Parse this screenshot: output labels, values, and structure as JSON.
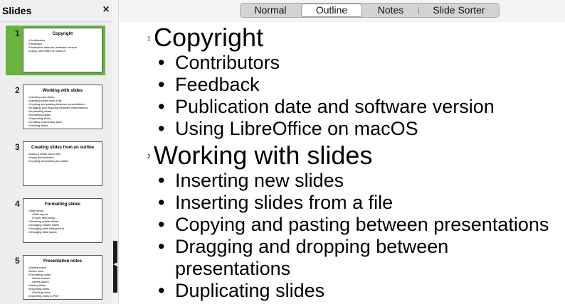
{
  "slides_pane": {
    "title": "Slides",
    "close_glyph": "×",
    "slides": [
      {
        "number": "1",
        "title": "Copyright",
        "items": [
          "Contributors",
          "Feedback",
          "Publication date and software version",
          "Using LibreOffice on macOS"
        ]
      },
      {
        "number": "2",
        "title": "Working with slides",
        "items": [
          "Inserting new slides",
          "Inserting slides from a file",
          "Copying and pasting between presentations",
          "Dragging and dropping between presentations",
          "Duplicating slides",
          "Renaming slides",
          "Expanding slides",
          "Creating a summary slide",
          "Deleting slides"
        ]
      },
      {
        "number": "3",
        "title": "Creating slides from an outline",
        "items": [
          "Using a Writer document",
          "Using AutoAbstract",
          "Copying and pasting an outline"
        ]
      },
      {
        "number": "4",
        "title": "Formatting slides",
        "items": [
          "Slide setup",
          "Slide layout",
          "Footer field setup",
          "Selecting master slides",
          "Changing master slides",
          "Changing slide background",
          "Changing slide layout"
        ]
      },
      {
        "number": "5",
        "title": "Presentation notes",
        "items": [
          "Adding notes",
          "Notes view",
          "Formatting notes",
          "Notes master",
          "Notes layout",
          "Adding fields",
          "Exporting notes",
          "Printing notes",
          "Exporting notes to PDF"
        ]
      }
    ]
  },
  "view_tabs": [
    "Normal",
    "Outline",
    "Notes",
    "Slide Sorter"
  ],
  "active_view": "Outline",
  "outline": [
    {
      "number": "1",
      "title": "Copyright",
      "bullets": [
        "Contributors",
        "Feedback",
        "Publication date and software version",
        "Using LibreOffice on macOS"
      ]
    },
    {
      "number": "2",
      "title": "Working with slides",
      "bullets": [
        "Inserting new slides",
        "Inserting slides from a file",
        "Copying and pasting between presentations",
        "Dragging and dropping between",
        "presentations",
        "Duplicating slides"
      ]
    }
  ],
  "colors": {
    "selected_slide": "#68b43f"
  },
  "icons": {
    "close": "close-icon",
    "collapse": "collapse-arrow-icon"
  }
}
